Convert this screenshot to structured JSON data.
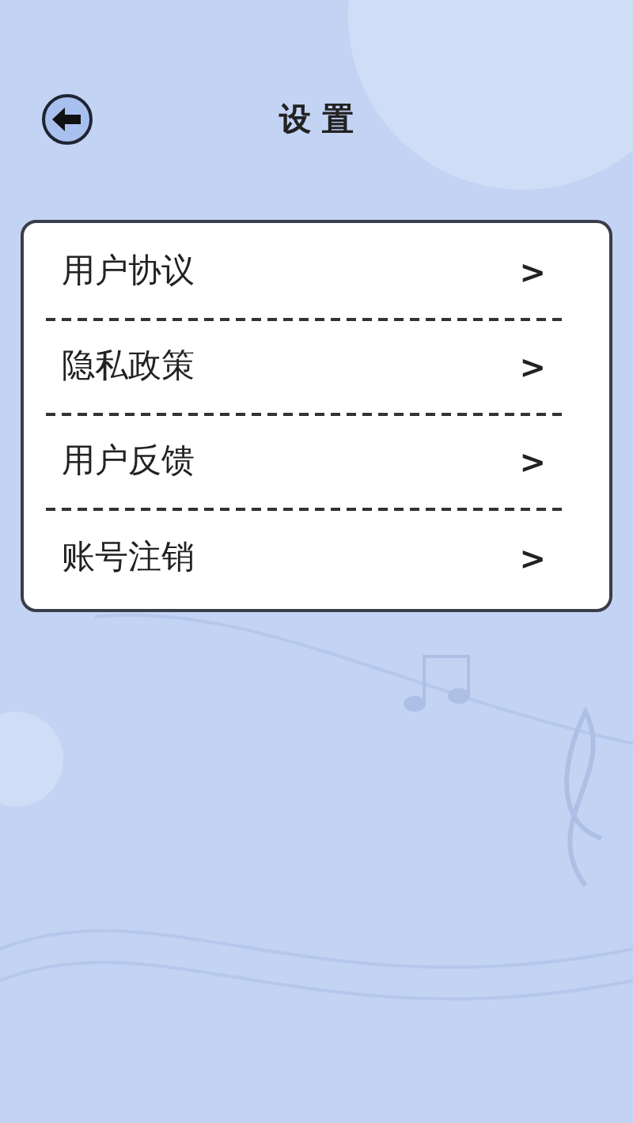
{
  "header": {
    "title": "设 置"
  },
  "menu": [
    {
      "label": "用户协议",
      "chevron": ">"
    },
    {
      "label": "隐私政策",
      "chevron": ">"
    },
    {
      "label": "用户反馈",
      "chevron": ">"
    },
    {
      "label": "账号注销",
      "chevron": ">"
    }
  ]
}
